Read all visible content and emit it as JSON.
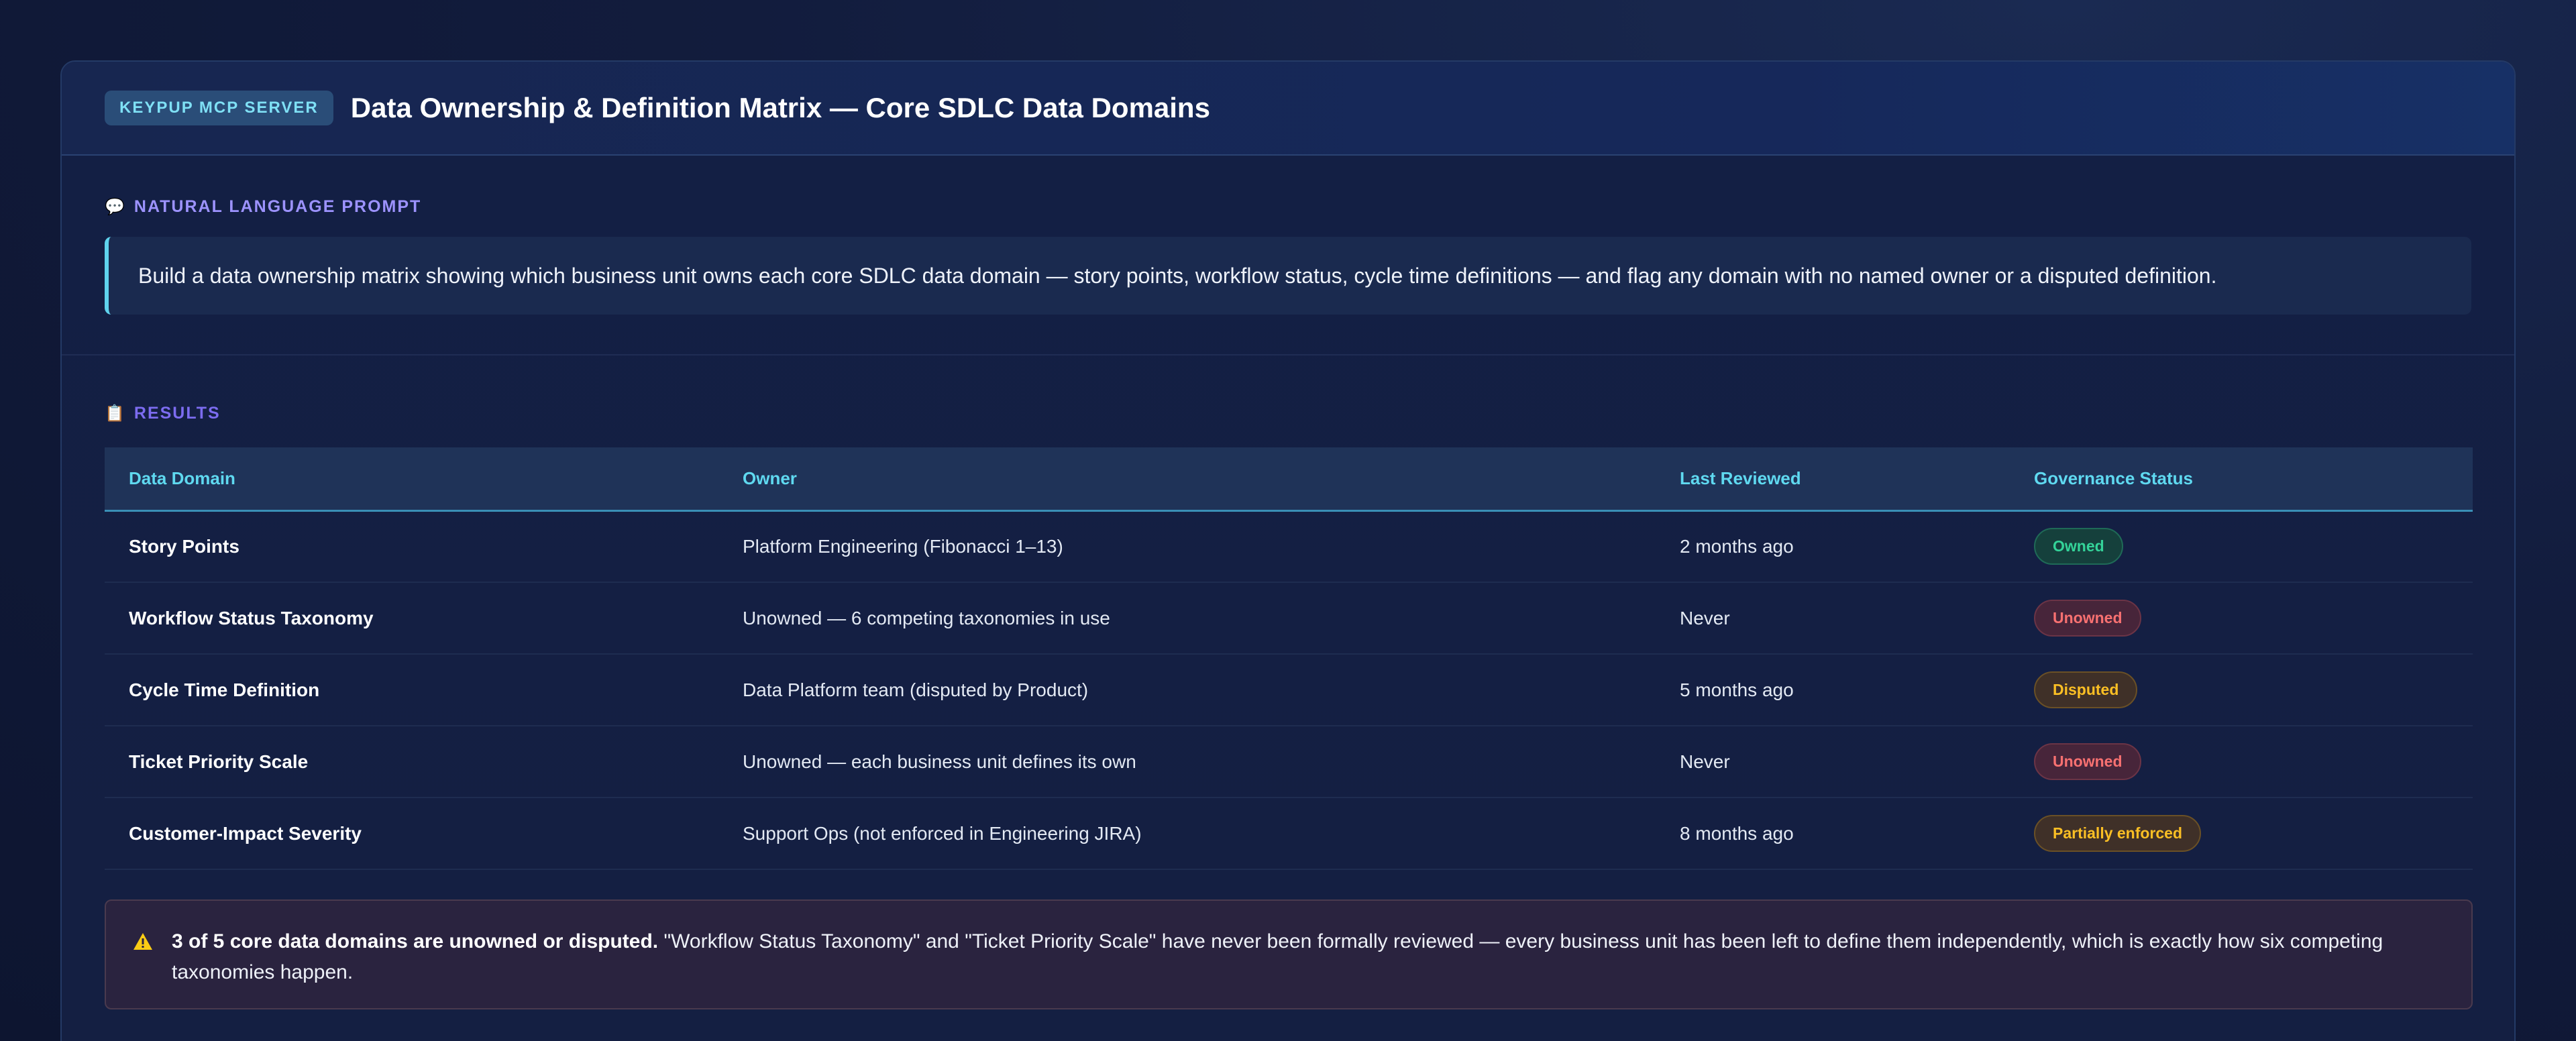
{
  "header": {
    "tag": "KEYPUP MCP SERVER",
    "title": "Data Ownership & Definition Matrix — Core SDLC Data Domains"
  },
  "prompt": {
    "label": "NATURAL LANGUAGE PROMPT",
    "icon": "speech-bubble-icon",
    "text": "Build a data ownership matrix showing which business unit owns each core SDLC data domain — story points, workflow status, cycle time definitions — and flag any domain with no named owner or a disputed definition."
  },
  "results": {
    "label": "RESULTS",
    "icon": "clipboard-icon",
    "columns": [
      "Data Domain",
      "Owner",
      "Last Reviewed",
      "Governance Status"
    ],
    "rows": [
      {
        "domain": "Story Points",
        "owner": "Platform Engineering (Fibonacci 1–13)",
        "reviewed": "2 months ago",
        "status": "Owned",
        "status_type": "owned"
      },
      {
        "domain": "Workflow Status Taxonomy",
        "owner": "Unowned — 6 competing taxonomies in use",
        "reviewed": "Never",
        "status": "Unowned",
        "status_type": "unowned"
      },
      {
        "domain": "Cycle Time Definition",
        "owner": "Data Platform team (disputed by Product)",
        "reviewed": "5 months ago",
        "status": "Disputed",
        "status_type": "disputed"
      },
      {
        "domain": "Ticket Priority Scale",
        "owner": "Unowned — each business unit defines its own",
        "reviewed": "Never",
        "status": "Unowned",
        "status_type": "unowned"
      },
      {
        "domain": "Customer-Impact Severity",
        "owner": "Support Ops (not enforced in Engineering JIRA)",
        "reviewed": "8 months ago",
        "status": "Partially enforced",
        "status_type": "partial"
      }
    ]
  },
  "warning": {
    "icon": "warning-icon",
    "bold": "3 of 5 core data domains are unowned or disputed.",
    "text": " \"Workflow Status Taxonomy\" and \"Ticket Priority Scale\" have never been formally reviewed — every business unit has been left to define them independently, which is exactly how six competing taxonomies happen."
  },
  "colors": {
    "accent": "#5fd9f0",
    "owned": "#34d399",
    "unowned": "#f87171",
    "disputed": "#fbbf24"
  }
}
